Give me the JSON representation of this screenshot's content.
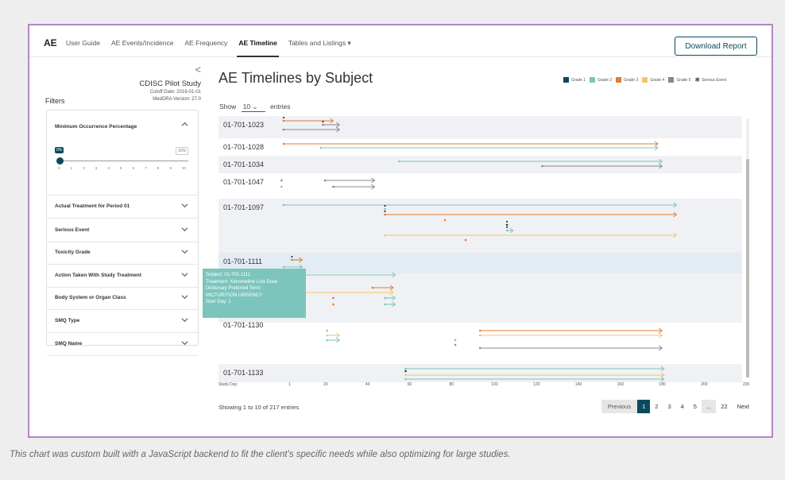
{
  "nav": {
    "brand": "AE",
    "links": [
      "User Guide",
      "AE Events/Incidence",
      "AE Frequency",
      "AE Timeline",
      "Tables and Listings ▾"
    ],
    "active": "AE Timeline",
    "download": "Download Report"
  },
  "sidebar": {
    "collapse_glyph": "<",
    "study": "CDISC Pilot Study",
    "cutoff": "Cutoff Date: 2016-01-01",
    "meddra": "MedDRA Version: 27.0",
    "filters_label": "Filters",
    "min_occ": {
      "label": "Minimum Occurrence Percentage",
      "value": "0%",
      "max": "10%",
      "ticks": [
        "0",
        "1",
        "2",
        "3",
        "4",
        "5",
        "6",
        "7",
        "8",
        "9",
        "10"
      ]
    },
    "filters": [
      "Actual Treatment for Period 01",
      "Serious Event",
      "Toxicity Grade",
      "Action Taken With Study Treatment",
      "Body System or Organ Class",
      "SMQ Type",
      "SMQ Name"
    ]
  },
  "main": {
    "title": "AE Timelines by Subject",
    "legend": [
      {
        "label": "Grade 1",
        "color": "#0b4a5e"
      },
      {
        "label": "Grade 2",
        "color": "#7cc5bc"
      },
      {
        "label": "Grade 3",
        "color": "#e07b39"
      },
      {
        "label": "Grade 4",
        "color": "#f5c56a"
      },
      {
        "label": "Grade 5",
        "color": "#888888"
      }
    ],
    "serious_label": "Serious Event",
    "serious_glyph": "✱",
    "show_prefix": "Show",
    "show_value": "10",
    "show_suffix": "entries",
    "study_day_label": "Study Day:",
    "study_day_ticks": [
      "1",
      "20",
      "40",
      "60",
      "80",
      "100",
      "120",
      "140",
      "160",
      "180",
      "200",
      "220"
    ],
    "showing": "Showing 1 to 10 of 217 entries",
    "pager": [
      "Previous",
      "1",
      "2",
      "3",
      "4",
      "5",
      "...",
      "22",
      "Next"
    ]
  },
  "subjects": [
    "01-701-1023",
    "01-701-1028",
    "01-701-1034",
    "01-701-1047",
    "01-701-1097",
    "01-701-1111",
    "01-701-1130",
    "01-701-1133"
  ],
  "tooltip": {
    "subject": "Subject: 01-701-1111",
    "treatment": "Treatment: Xanomeline Low Dose",
    "term_label": "Dictionary Preferred Term:",
    "term": "MICTURITION URGENCY",
    "start": "Start Day: 1"
  },
  "caption": "This chart was custom built with a JavaScript backend to fit the client's specific needs while also optimizing for large studies.",
  "chart_data": {
    "type": "timeline",
    "x_axis": {
      "label": "Study Day:",
      "range": [
        1,
        220
      ]
    },
    "events": [
      {
        "subject": "01-701-1023",
        "lane": 0,
        "start": 1,
        "end": 25,
        "grade": 3,
        "serious": true
      },
      {
        "subject": "01-701-1023",
        "lane": 1,
        "start": 20,
        "end": 28,
        "grade": 5,
        "serious": true
      },
      {
        "subject": "01-701-1023",
        "lane": 2,
        "start": 1,
        "end": 28,
        "grade": 5,
        "serious": false
      },
      {
        "subject": "01-701-1028",
        "lane": 0,
        "start": 1,
        "end": 182,
        "grade": 3,
        "serious": false
      },
      {
        "subject": "01-701-1028",
        "lane": 1,
        "start": 19,
        "end": 182,
        "grade": 2,
        "serious": false
      },
      {
        "subject": "01-701-1034",
        "lane": 0,
        "start": 57,
        "end": 184,
        "grade": 2,
        "serious": false
      },
      {
        "subject": "01-701-1034",
        "lane": 1,
        "start": 126,
        "end": 184,
        "grade": 5,
        "serious": false
      },
      {
        "subject": "01-701-1047",
        "lane": 0,
        "start": 0,
        "end": 0,
        "grade": 5,
        "serious": false
      },
      {
        "subject": "01-701-1047",
        "lane": 1,
        "start": 0,
        "end": 0,
        "grade": 2,
        "serious": false
      },
      {
        "subject": "01-701-1047",
        "lane": 0,
        "start": 21,
        "end": 45,
        "grade": 5,
        "serious": false
      },
      {
        "subject": "01-701-1047",
        "lane": 1,
        "start": 25,
        "end": 45,
        "grade": 5,
        "serious": false
      },
      {
        "subject": "01-701-1097",
        "lane": 0,
        "start": 1,
        "end": 191,
        "grade": 2,
        "serious": false
      },
      {
        "subject": "01-701-1097",
        "lane": 1,
        "start": 50,
        "end": 50,
        "grade": 2,
        "serious": true
      },
      {
        "subject": "01-701-1097",
        "lane": 2,
        "start": 50,
        "end": 191,
        "grade": 3,
        "serious": true
      },
      {
        "subject": "01-701-1097",
        "lane": 3,
        "start": 79,
        "end": 79,
        "grade": 3,
        "serious": false
      },
      {
        "subject": "01-701-1097",
        "lane": 4,
        "start": 109,
        "end": 109,
        "grade": 1,
        "serious": true
      },
      {
        "subject": "01-701-1097",
        "lane": 5,
        "start": 109,
        "end": 112,
        "grade": 2,
        "serious": true
      },
      {
        "subject": "01-701-1097",
        "lane": 6,
        "start": 50,
        "end": 191,
        "grade": 4,
        "serious": false
      },
      {
        "subject": "01-701-1097",
        "lane": 7,
        "start": 89,
        "end": 89,
        "grade": 3,
        "serious": false
      },
      {
        "subject": "01-701-1111",
        "lane": 0,
        "start": 5,
        "end": 10,
        "grade": 3,
        "serious": true
      },
      {
        "subject": "01-701-1111",
        "lane": 1,
        "start": 1,
        "end": 10,
        "grade": 2,
        "serious": false
      },
      {
        "subject": "01-701-1111",
        "lane": 2,
        "start": 1,
        "end": 55,
        "grade": 2,
        "serious": false
      },
      {
        "subject": "01-701-1111",
        "lane": 3,
        "start": 44,
        "end": 54,
        "grade": 3,
        "serious": false
      },
      {
        "subject": "01-701-1111",
        "lane": 4,
        "start": 1,
        "end": 54,
        "grade": 4,
        "serious": false
      },
      {
        "subject": "01-701-1111",
        "lane": 5,
        "start": 25,
        "end": 25,
        "grade": 3,
        "serious": false
      },
      {
        "subject": "01-701-1111",
        "lane": 5,
        "start": 50,
        "end": 55,
        "grade": 2,
        "serious": false
      },
      {
        "subject": "01-701-1111",
        "lane": 6,
        "start": 25,
        "end": 25,
        "grade": 3,
        "serious": false
      },
      {
        "subject": "01-701-1111",
        "lane": 6,
        "start": 50,
        "end": 55,
        "grade": 2,
        "serious": false
      },
      {
        "subject": "01-701-1130",
        "lane": 0,
        "start": 22,
        "end": 22,
        "grade": 2,
        "serious": false
      },
      {
        "subject": "01-701-1130",
        "lane": 1,
        "start": 22,
        "end": 28,
        "grade": 4,
        "serious": false
      },
      {
        "subject": "01-701-1130",
        "lane": 0,
        "start": 96,
        "end": 184,
        "grade": 3,
        "serious": false
      },
      {
        "subject": "01-701-1130",
        "lane": 1,
        "start": 96,
        "end": 184,
        "grade": 4,
        "serious": false
      },
      {
        "subject": "01-701-1130",
        "lane": 2,
        "start": 84,
        "end": 84,
        "grade": 2,
        "serious": false
      },
      {
        "subject": "01-701-1130",
        "lane": 2,
        "start": 22,
        "end": 28,
        "grade": 2,
        "serious": false
      },
      {
        "subject": "01-701-1130",
        "lane": 3,
        "start": 84,
        "end": 84,
        "grade": 3,
        "serious": false
      },
      {
        "subject": "01-701-1130",
        "lane": 4,
        "start": 96,
        "end": 184,
        "grade": 5,
        "serious": false
      },
      {
        "subject": "01-701-1133",
        "lane": 0,
        "start": 60,
        "end": 185,
        "grade": 2,
        "serious": false
      },
      {
        "subject": "01-701-1133",
        "lane": 1,
        "start": 60,
        "end": 60,
        "grade": 1,
        "serious": false
      },
      {
        "subject": "01-701-1133",
        "lane": 2,
        "start": 60,
        "end": 185,
        "grade": 4,
        "serious": false
      },
      {
        "subject": "01-701-1133",
        "lane": 3,
        "start": 60,
        "end": 185,
        "grade": 2,
        "serious": false
      }
    ]
  }
}
